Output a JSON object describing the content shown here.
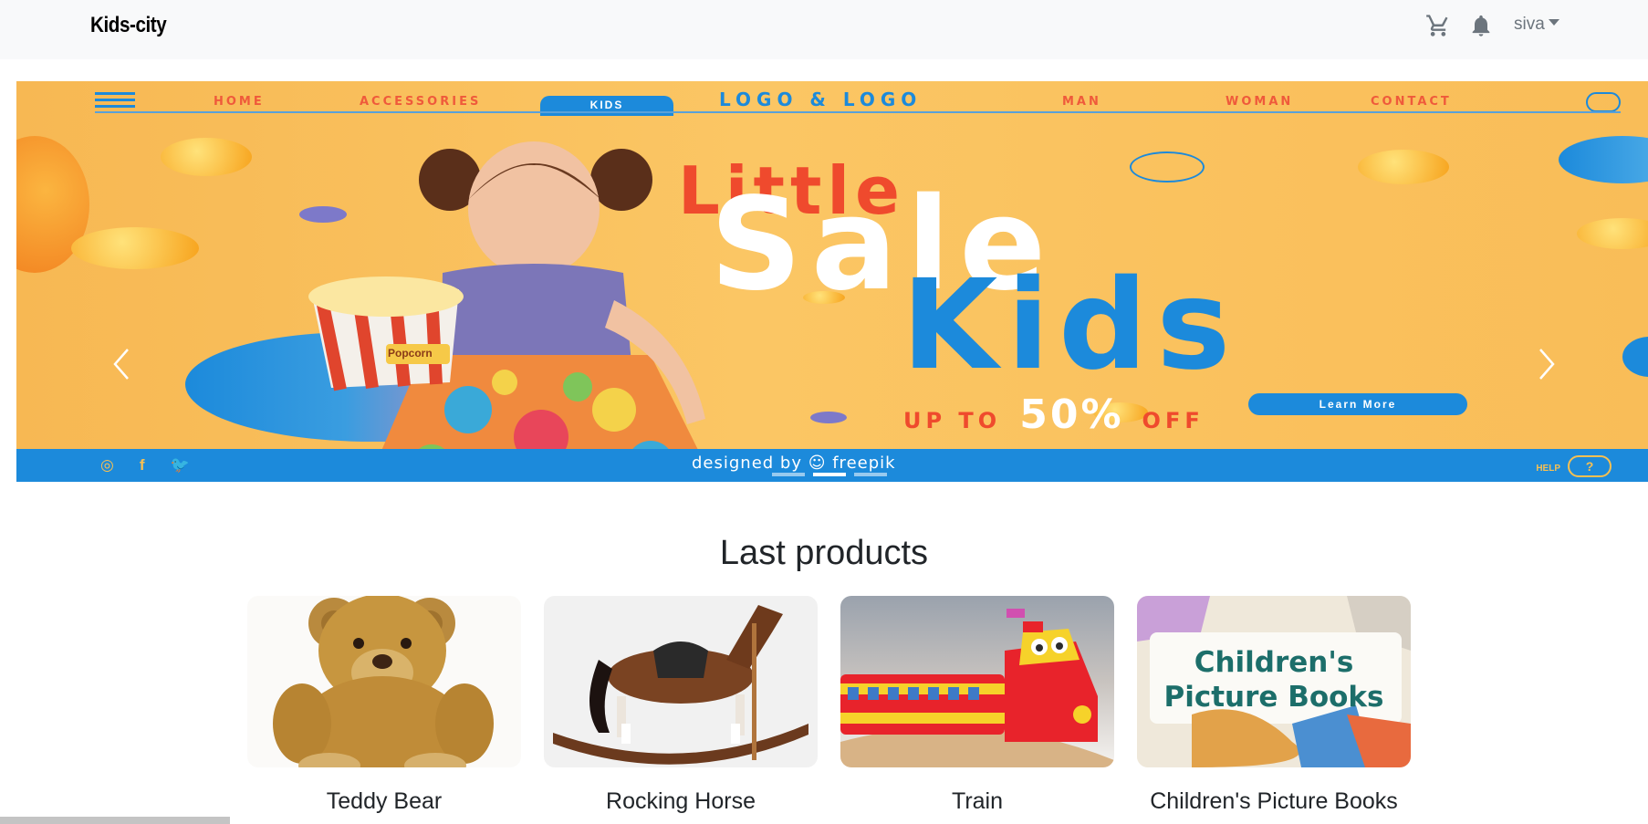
{
  "navbar": {
    "brand": "Kids-city",
    "user": "siva"
  },
  "banner": {
    "nav_items": [
      "HOME",
      "ACCESSORIES",
      "KIDS",
      "LOGO & LOGO",
      "MAN",
      "WOMAN",
      "CONTACT"
    ],
    "headline_little": "Little",
    "headline_sale": "Sale",
    "headline_kids": "Kids",
    "offer_prefix": "UP TO",
    "offer_value": "50%",
    "offer_suffix": "OFF",
    "cta": "Learn More",
    "credit": "designed by ☺ freepik",
    "help": "HELP",
    "help_symbol": "?",
    "social": [
      "◎",
      "f",
      "🐦"
    ],
    "popcorn_label": "Popcorn"
  },
  "carousel": {
    "slide_count": 3,
    "active_index": 1
  },
  "products_section": {
    "title": "Last products",
    "products": [
      {
        "name": "Teddy Bear"
      },
      {
        "name": "Rocking Horse"
      },
      {
        "name": "Train"
      },
      {
        "name": "Children's Picture Books"
      }
    ]
  },
  "books_cover_text": "Children's Picture Books",
  "colors": {
    "navbar_bg": "#f8f9fa",
    "banner_bg": "#fbc664",
    "banner_blue": "#1c8adb",
    "banner_red": "#ef4a2d"
  }
}
